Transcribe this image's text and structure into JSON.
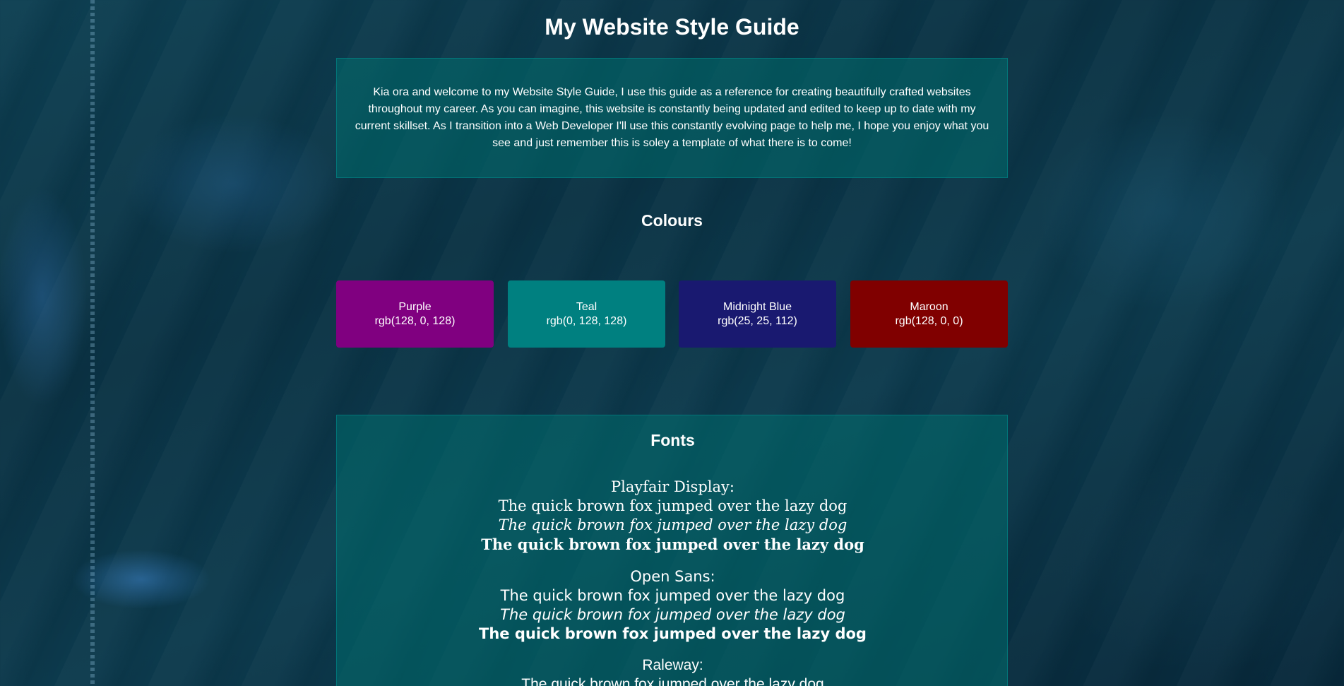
{
  "page_title": "My Website Style Guide",
  "intro": "Kia ora and welcome to my Website Style Guide, I use this guide as a reference for creating beautifully crafted websites throughout my career. As you can imagine, this website is constantly being updated and edited to keep up to date with my current skillset. As I transition into a Web Developer I'll use this constantly evolving page to help me, I hope you enjoy what you see and just remember this is soley a template of what there is to come!",
  "colours": {
    "heading": "Colours",
    "swatches": [
      {
        "name": "Purple",
        "value": "rgb(128, 0, 128)",
        "hex": "#800080"
      },
      {
        "name": "Teal",
        "value": "rgb(0, 128, 128)",
        "hex": "#008080"
      },
      {
        "name": "Midnight Blue",
        "value": "rgb(25, 25, 112)",
        "hex": "#191970"
      },
      {
        "name": "Maroon",
        "value": "rgb(128, 0, 0)",
        "hex": "#800000"
      }
    ]
  },
  "fonts": {
    "heading": "Fonts",
    "groups": [
      {
        "label": "Playfair Display:",
        "regular": "The quick brown fox jumped over the lazy dog",
        "italic": "The quick brown fox jumped over the lazy dog",
        "bold": "The quick brown fox jumped over the lazy dog"
      },
      {
        "label": "Open Sans:",
        "regular": "The quick brown fox jumped over the lazy dog",
        "italic": "The quick brown fox jumped over the lazy dog",
        "bold": "The quick brown fox jumped over the lazy dog"
      },
      {
        "label": "Raleway:",
        "regular": "The quick brown fox jumped over the lazy dog"
      }
    ]
  }
}
